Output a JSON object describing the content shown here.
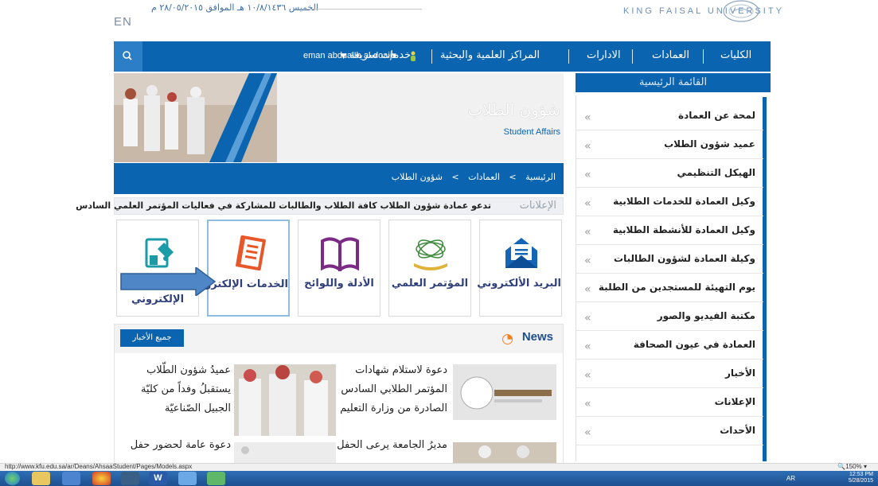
{
  "header": {
    "date_text": "الخميس ١٠/٨/١٤٣٦ هـ الموافق ٢٨/٠٥/٢٠١٥ م",
    "lang_link": "EN",
    "university_name": "KING FAISAL UNIVERSITY"
  },
  "nav": {
    "items": [
      {
        "label": "الكليات"
      },
      {
        "label": "العمادات"
      },
      {
        "label": "الادارات"
      },
      {
        "label": "المراكز العلمية والبحثية"
      },
      {
        "label": "خدمات سريعة"
      }
    ],
    "username": "eman abdualIh al-doaij▾",
    "search_icon": "search-icon",
    "colors": {
      "primary": "#0b64b0",
      "search": "#2c7ec7"
    }
  },
  "sidebar": {
    "title": "القائمة الرئيسية",
    "items": [
      {
        "label": "لمحة عن العمادة"
      },
      {
        "label": "عميد شؤون الطلاب"
      },
      {
        "label": "الهيكل التنظيمي"
      },
      {
        "label": "وكيل العمادة للخدمات الطلابية"
      },
      {
        "label": "وكيل العمادة للأنشطة الطلابية"
      },
      {
        "label": "وكيلة العمادة لشؤون الطالبات"
      },
      {
        "label": "يوم التهيئة للمستجدين من الطلبة"
      },
      {
        "label": "مكتبة الفيديو والصور"
      },
      {
        "label": "العمادة في عيون الصحافة"
      },
      {
        "label": "الأخبار"
      },
      {
        "label": "الإعلانات"
      },
      {
        "label": "الأحداث"
      }
    ]
  },
  "banner": {
    "title": "شؤون الطلاب",
    "subtitle": "Student Affairs"
  },
  "breadcrumb": {
    "home": "الرئيسية",
    "deans": "العمادات",
    "current": "شؤون الطلاب",
    "sep": ">"
  },
  "announcements": {
    "label": "الإعلانات",
    "text": "تدعو عمادة شؤون الطلاب كافة الطلاب والطالبات للمشاركة في فعاليات المؤتمر العلمي السادس"
  },
  "tiles": [
    {
      "label": "البريد الألكتروني",
      "icon": "mail-icon"
    },
    {
      "label": "المؤتمر العلمي",
      "icon": "conference-icon"
    },
    {
      "label": "الأدلة واللوائح",
      "icon": "book-icon"
    },
    {
      "label": "الخدمات الإلكترونية",
      "icon": "eservices-icon"
    },
    {
      "label": "الإلكتروني",
      "icon": "eform-icon"
    }
  ],
  "news": {
    "title": "News",
    "all_news_button": "جميع الأخبار",
    "items": [
      {
        "text": "دعوة لاستلام شهادات المؤتمر الطلابي السادس الصادرة من وزارة التعليم"
      },
      {
        "text": "عميدُ شؤون الطّلاب يستقبلُ وفداً من كليّة الجبيل الصّناعيّة"
      },
      {
        "text": "مديرُ الجامعة يرعى الحفل"
      },
      {
        "text": "دعوة عامة لحضور حفل"
      }
    ]
  },
  "statusbar": {
    "url": "http://www.kfu.edu.sa/ar/Deans/AhsaaStudent/Pages/Models.aspx",
    "zoom": "150%"
  },
  "taskbar": {
    "lang": "AR",
    "time": "12:53 PM",
    "date": "5/28/2015"
  }
}
